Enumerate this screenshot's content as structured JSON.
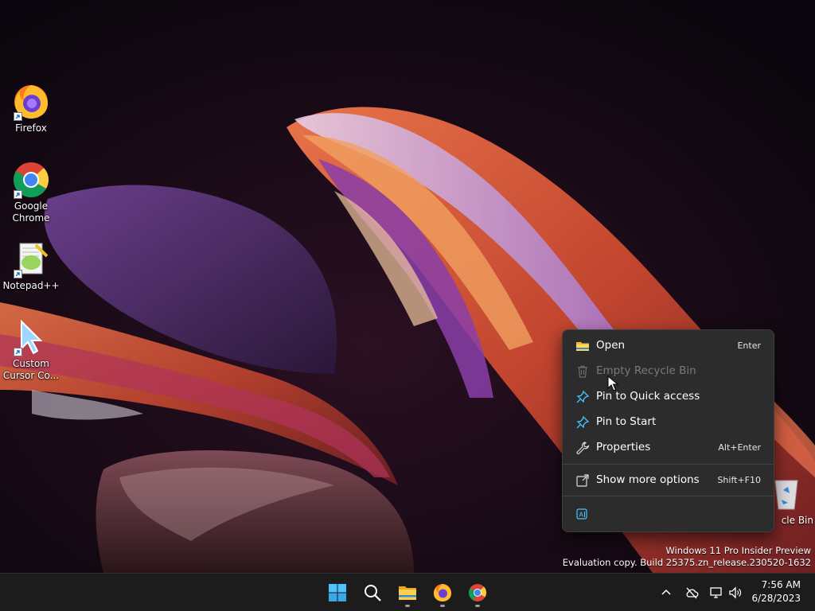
{
  "desktop": {
    "icons": [
      {
        "label": "Firefox"
      },
      {
        "label": "Google\nChrome"
      },
      {
        "label": "Notepad++"
      },
      {
        "label": "Custom\nCursor Co..."
      }
    ],
    "recycle_bin_label": "cle Bin"
  },
  "context_menu": {
    "items": [
      {
        "label": "Open",
        "shortcut": "Enter",
        "icon": "folder-icon",
        "disabled": false
      },
      {
        "label": "Empty Recycle Bin",
        "shortcut": "",
        "icon": "trash-icon",
        "disabled": true
      },
      {
        "label": "Pin to Quick access",
        "shortcut": "",
        "icon": "pin-icon",
        "disabled": false
      },
      {
        "label": "Pin to Start",
        "shortcut": "",
        "icon": "pin-icon",
        "disabled": false
      },
      {
        "label": "Properties",
        "shortcut": "Alt+Enter",
        "icon": "wrench-icon",
        "disabled": false
      },
      {
        "label": "Show more options",
        "shortcut": "Shift+F10",
        "icon": "share-icon",
        "disabled": false
      }
    ],
    "bottom_icon": "ai-rename-icon"
  },
  "watermark": {
    "line1": "Windows 11 Pro Insider Preview",
    "line2": "Evaluation copy. Build 25375.zn_release.230520-1632"
  },
  "taskbar": {
    "apps": [
      "start-icon",
      "search-icon",
      "file-explorer-icon",
      "firefox-icon",
      "chrome-icon"
    ],
    "tray": [
      "chevron-up-icon",
      "cloud-offline-icon",
      "network-icon",
      "volume-icon"
    ],
    "time": "7:56 AM",
    "date": "6/28/2023"
  },
  "colors": {
    "menu_bg": "#2c2c2c",
    "taskbar_bg": "#1c1c1c",
    "accent_blue": "#4cc2ff"
  }
}
